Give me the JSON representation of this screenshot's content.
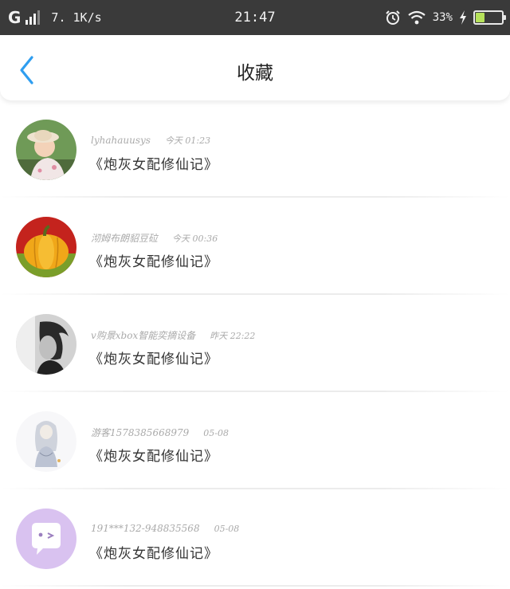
{
  "status_bar": {
    "carrier": "G",
    "net_speed": "7. 1K/s",
    "time": "21:47",
    "battery_percent_text": "33%",
    "battery_level": 0.33,
    "icons": [
      "signal-icon",
      "alarm-icon",
      "wifi-icon",
      "charge-icon",
      "battery-icon"
    ]
  },
  "header": {
    "title": "收藏",
    "back_icon": "chevron-left-icon",
    "accent_color": "#2f9ef0"
  },
  "favorites": [
    {
      "username": "lyhahauusys",
      "time": "今天 01:23",
      "book": "《炮灰女配修仙记》",
      "avatar": "girl-photo"
    },
    {
      "username": "沏姆布朗貂豆砬",
      "time": "今天 00:36",
      "book": "《炮灰女配修仙记》",
      "avatar": "pumpkin"
    },
    {
      "username": "v购景xbox智能奕摘设备",
      "time": "昨天 22:22",
      "book": "《炮灰女配修仙记》",
      "avatar": "boy-photo"
    },
    {
      "username": "游客1578385668979",
      "time": "05-08",
      "book": "《炮灰女配修仙记》",
      "avatar": "anime-sketch"
    },
    {
      "username": "191***132-948835568",
      "time": "05-08",
      "book": "《炮灰女配修仙记》",
      "avatar": "chat-bubble"
    }
  ]
}
